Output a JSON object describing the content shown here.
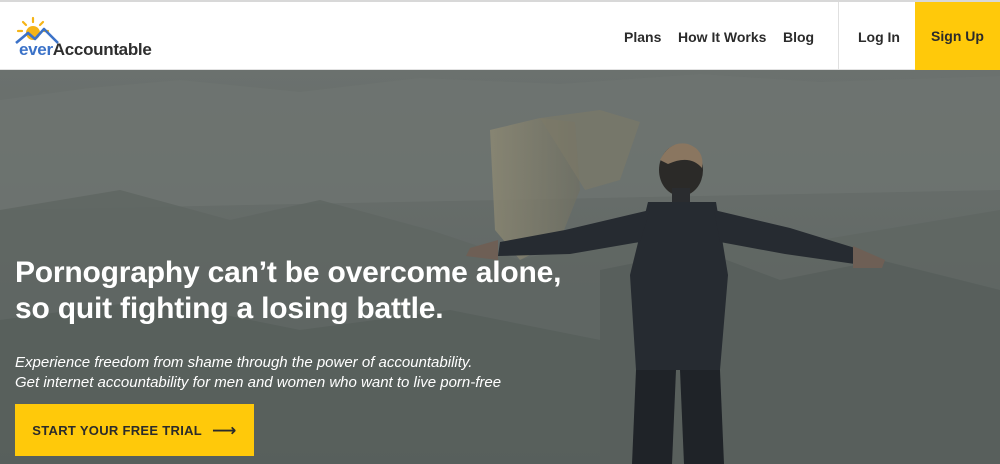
{
  "brand": {
    "logo_prefix": "ever",
    "logo_suffix": "Accountable",
    "accent": "#ffc90a",
    "blue": "#3b72c8"
  },
  "nav": {
    "plans": "Plans",
    "how_it_works": "How It Works",
    "blog": "Blog",
    "login": "Log In",
    "signup": "Sign Up"
  },
  "hero": {
    "headline_line1": "Pornography can’t be overcome alone,",
    "headline_line2": "so quit fighting a losing battle.",
    "sub_line1": "Experience freedom from shame through the power of accountability.",
    "sub_line2": "Get internet accountability for men and women who want to live porn-free",
    "cta_label": "START YOUR FREE TRIAL",
    "cta_arrow": "⟶"
  }
}
